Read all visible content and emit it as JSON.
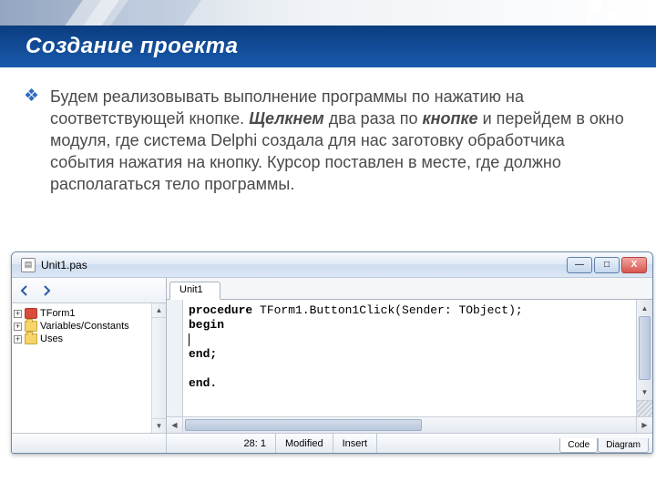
{
  "slide": {
    "title": "Создание проекта",
    "bullet": "❖",
    "para": {
      "t1": "Будем реализовывать выполнение программы по нажатию  на соответствующей кнопке. ",
      "em1": "Щелкнем",
      "t2": " два раза по ",
      "em2": "кнопке",
      "t3": " и перейдем в окно модуля, где система Delphi создала для нас заготовку обработчика события нажатия на кнопку. Курсор поставлен в месте, где должно располагаться тело программы."
    }
  },
  "ide": {
    "title": "Unit1.pas",
    "win": {
      "min": "—",
      "max": "□",
      "close": "X"
    },
    "tree": {
      "items": [
        {
          "label": "TForm1",
          "icon": "form"
        },
        {
          "label": "Variables/Constants",
          "icon": "folder"
        },
        {
          "label": "Uses",
          "icon": "folder"
        }
      ]
    },
    "tab": "Unit1",
    "code": {
      "l1a": "procedure",
      "l1b": " TForm1.Button1Click(Sender: TObject);",
      "l2": "begin",
      "l3": "",
      "l4": "end;",
      "l5": "",
      "l6": "end."
    },
    "status": {
      "pos": "28:   1",
      "modified": "Modified",
      "insert": "Insert"
    },
    "viewTabs": {
      "code": "Code",
      "diagram": "Diagram"
    }
  }
}
